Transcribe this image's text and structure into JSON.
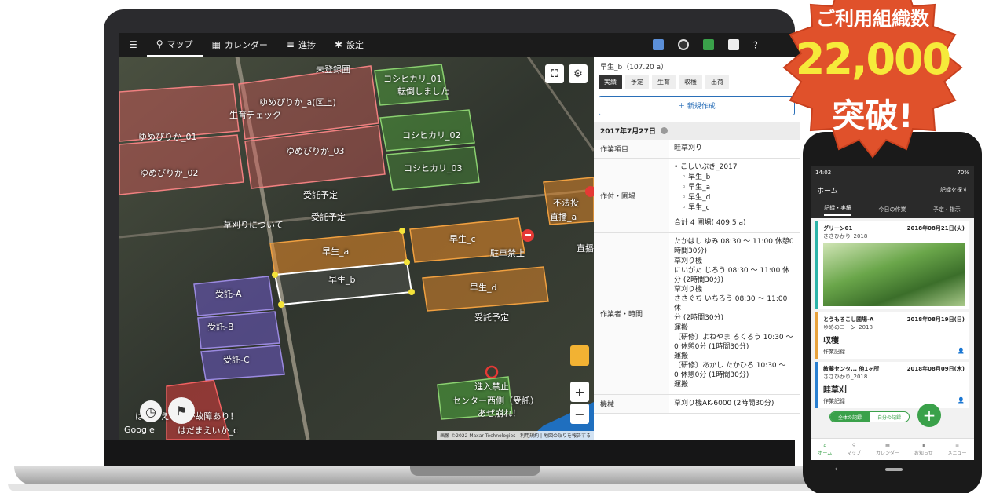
{
  "nav": {
    "items": [
      {
        "icon": "menu",
        "label": ""
      },
      {
        "icon": "map-pin",
        "label": "マップ"
      },
      {
        "icon": "calendar",
        "label": "カレンダー"
      },
      {
        "icon": "list",
        "label": "進捗"
      },
      {
        "icon": "gear",
        "label": "設定"
      }
    ],
    "help_label": "？"
  },
  "map": {
    "labels": {
      "a": "未登録圃",
      "b": "ゆめぴりか_a(区上)",
      "c": "生育チェック",
      "d": "ゆめぴりか_01",
      "e": "ゆめぴりか_03",
      "f": "ゆめぴりか_02",
      "g": "コシヒカリ_01",
      "h": "転倒しました",
      "i": "コシヒカリ_02",
      "j": "コシヒカリ_03",
      "k": "受託予定",
      "l": "受託予定",
      "m": "草刈りについて",
      "n": "早生_a",
      "o": "早生_b",
      "p": "早生_c",
      "q": "駐車禁止",
      "r": "早生_d",
      "s": "受託予定",
      "t": "受託-A",
      "u": "受託-B",
      "v": "受託-C",
      "w": "不法投",
      "x": "直播_a",
      "y": "直播",
      "z": "進入禁止",
      "aa": "センター西側（受託）",
      "ab": "あぜ崩れ！",
      "ac": "はだまえいかが故障あり！",
      "ad": "はだまえいか_c"
    },
    "google": "Google",
    "attribution": "画像 ©2022 Maxar Technologies | 利用規約 | 地図の誤りを報告する",
    "zoom_in": "+",
    "zoom_out": "−"
  },
  "panel": {
    "title": "早生_b（107.20 a）",
    "tabs": [
      "実績",
      "予定",
      "生育",
      "収穫",
      "出荷"
    ],
    "new_button": "＋ 新規作成",
    "date": "2017年7月27日",
    "rows": {
      "work_item_key": "作業項目",
      "work_item_val": "畦草刈り",
      "field_key": "作付・圃場",
      "field_main": "こしいぶき_2017",
      "field_subs": [
        "早生_b",
        "早生_a",
        "早生_d",
        "早生_c"
      ],
      "field_total": "合計 4 圃場( 409.5 a)",
      "worker_key": "作業者・時間",
      "worker_lines": [
        "たかはし ゆみ 08:30 〜 11:00 休憩0",
        "時間30分)",
        "草刈り機",
        "にいがた じろう 08:30 〜 11:00 休",
        "分 (2時間30分)",
        "草刈り機",
        "ささぐち いちろう 08:30 〜 11:00 休",
        "分 (2時間30分)",
        "運搬",
        "〔研修〕よねやま ろくろう 10:30 〜",
        "0 休憩0分 (1時間30分)",
        "運搬",
        "〔研修〕あかし たかひろ 10:30 〜",
        "0 休憩0分 (1時間30分)",
        "運搬"
      ],
      "machine_key": "機械",
      "machine_val": "草刈り機AK-6000 (2時間30分)"
    }
  },
  "badge": {
    "line1": "ご利用組織数",
    "line2": "22,000",
    "line3": "突破!"
  },
  "phone": {
    "status_time": "14:02",
    "status_right": "70%",
    "home": "ホーム",
    "filter": "記録を探す",
    "tabs": [
      "記録・実績",
      "今日の作業",
      "予定・指示"
    ],
    "cards": [
      {
        "title": "グリーン01",
        "date": "2018年08月21日(火)",
        "sub": "ささひかり_2018"
      },
      {
        "title": "とうもろこし圃場-A",
        "date": "2018年08月19日(日)",
        "sub": "ゆめのコーン_2018",
        "main": "収穫",
        "foot": "作業記録"
      },
      {
        "title": "教養センタ... 他1ヶ所",
        "date": "2018年08月09日(木)",
        "sub": "ささひかり_2018",
        "main": "畦草刈",
        "foot": "作業記録"
      }
    ],
    "toggle": [
      "全体の記録",
      "自分の記録"
    ],
    "bottom": [
      "ホーム",
      "マップ",
      "カレンダー",
      "お知らせ",
      "メニュー"
    ]
  }
}
